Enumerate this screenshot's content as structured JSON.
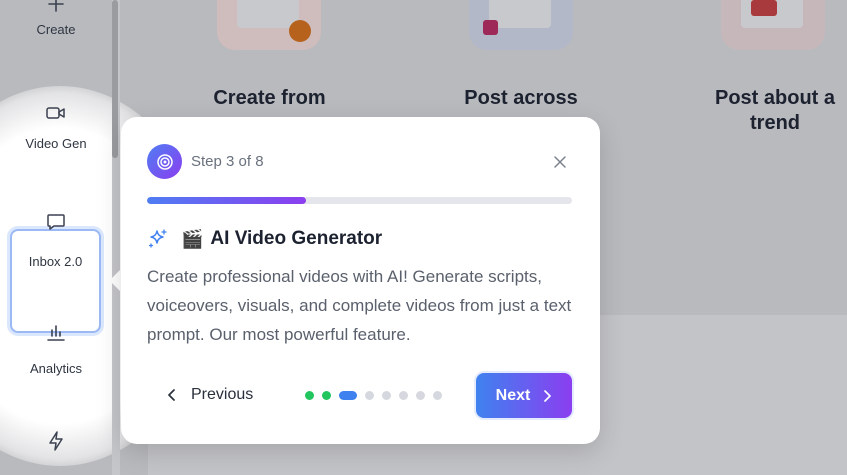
{
  "sidebar": {
    "items": [
      {
        "label": "Create",
        "icon": "plus-icon"
      },
      {
        "label": "Video Gen",
        "icon": "video-camera-icon"
      },
      {
        "label": "Inbox 2.0",
        "icon": "chat-bubble-icon"
      },
      {
        "label": "Analytics",
        "icon": "bar-chart-icon"
      },
      {
        "label": "",
        "icon": "lightning-icon"
      }
    ]
  },
  "main": {
    "cards": [
      {
        "title": "Create from"
      },
      {
        "title": "Post across"
      },
      {
        "title": "Post about a trend"
      }
    ]
  },
  "tour": {
    "step_text": "Step 3 of 8",
    "current_step": 3,
    "total_steps": 8,
    "progress_fraction": 0.375,
    "title_emoji": "🎬",
    "title": "AI Video Generator",
    "description": "Create professional videos with AI! Generate scripts, voiceovers, visuals, and complete videos from just a text prompt. Our most powerful feature.",
    "previous_label": "Previous",
    "next_label": "Next",
    "colors": {
      "accent_start": "#4f7df3",
      "accent_end": "#8b3ef0",
      "done_dot": "#22c55e",
      "active_dot": "#3f82ef"
    }
  }
}
